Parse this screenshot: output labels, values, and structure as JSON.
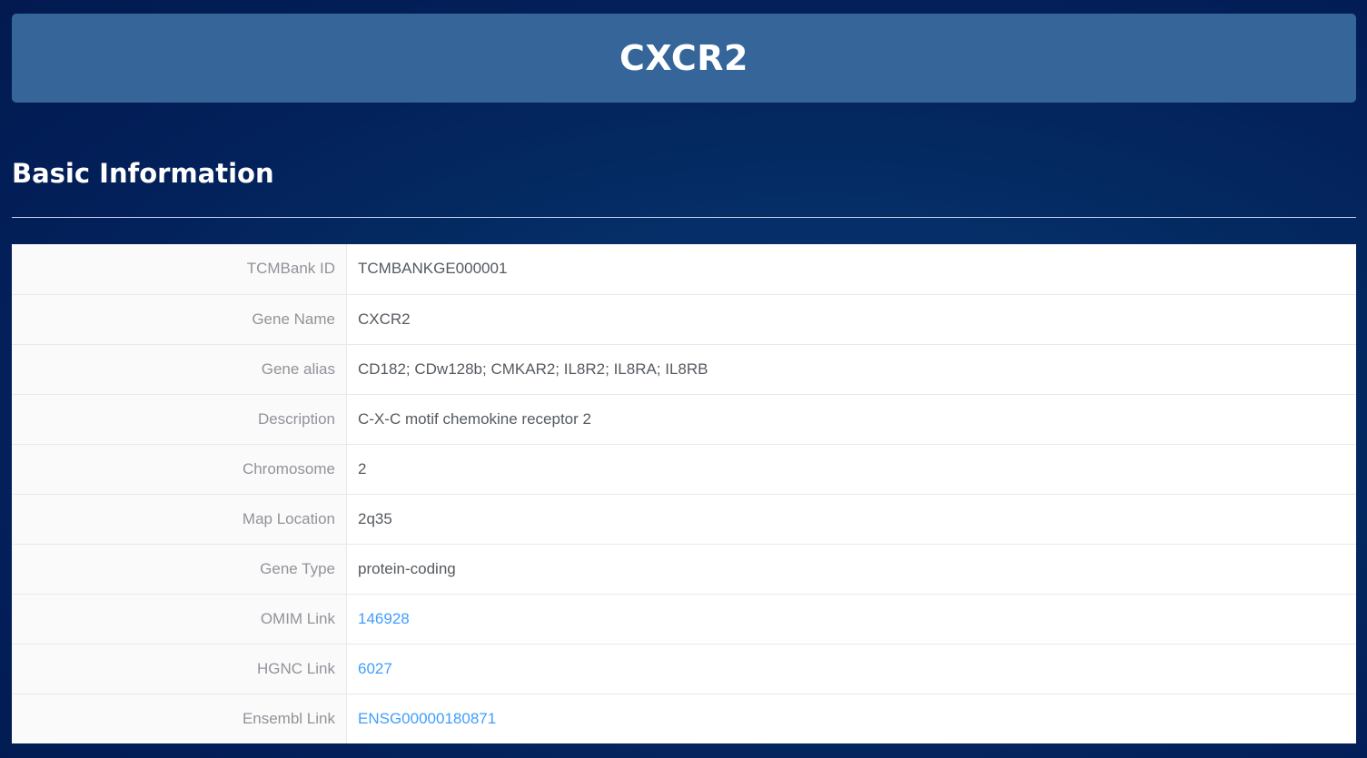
{
  "header": {
    "title": "CXCR2"
  },
  "basic_info": {
    "heading": "Basic Information",
    "rows": [
      {
        "label": "TCMBank ID",
        "value": "TCMBANKGE000001"
      },
      {
        "label": "Gene Name",
        "value": "CXCR2"
      },
      {
        "label": "Gene alias",
        "value": "CD182; CDw128b; CMKAR2; IL8R2; IL8RA; IL8RB"
      },
      {
        "label": "Description",
        "value": "C-X-C motif chemokine receptor 2"
      },
      {
        "label": "Chromosome",
        "value": "2"
      },
      {
        "label": "Map Location",
        "value": "2q35"
      },
      {
        "label": "Gene Type",
        "value": "protein-coding"
      },
      {
        "label": "OMIM Link",
        "value": "146928"
      },
      {
        "label": "HGNC Link",
        "value": "6027"
      },
      {
        "label": "Ensembl Link",
        "value": "ENSG00000180871"
      }
    ]
  },
  "colors": {
    "title_bar": "#356599",
    "link": "#409eff",
    "label_text": "#909399",
    "value_text": "#555a60"
  }
}
